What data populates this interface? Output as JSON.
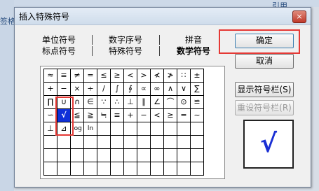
{
  "background": {
    "left_label": "签格",
    "right_label": "引用"
  },
  "dialog": {
    "title": "插入特殊符号",
    "close_symbol": "×",
    "tabs": {
      "row1": [
        "单位符号",
        "数字序号",
        "拼音"
      ],
      "row2": [
        "标点符号",
        "特殊符号",
        "数学符号"
      ],
      "active": "数学符号"
    },
    "grid": [
      [
        "≈",
        "≡",
        "≠",
        "=",
        "≤",
        "≥",
        "<",
        ">",
        "≮",
        "≯",
        "∷",
        "±"
      ],
      [
        "+",
        "−",
        "×",
        "÷",
        "/",
        "∫",
        "∮",
        "∝",
        "∞",
        "∧",
        "∨",
        "∑"
      ],
      [
        "∏",
        "∪",
        "∩",
        "∈",
        "∵",
        "∴",
        "⊥",
        "∥",
        "∠",
        "⌒",
        "⊙",
        "≌"
      ],
      [
        "∽",
        "√",
        "≦",
        "≧",
        "≒",
        "≡",
        "+",
        "−",
        "<",
        "≥",
        "=",
        "~"
      ],
      [
        "⊥",
        "⊿",
        "log",
        "ln",
        "",
        "",
        "",
        "",
        "",
        "",
        "",
        ""
      ],
      [
        "",
        "",
        "",
        "",
        "",
        "",
        "",
        "",
        "",
        "",
        "",
        ""
      ],
      [
        "",
        "",
        "",
        "",
        "",
        "",
        "",
        "",
        "",
        "",
        "",
        ""
      ],
      [
        "",
        "",
        "",
        "",
        "",
        "",
        "",
        "",
        "",
        "",
        "",
        ""
      ]
    ],
    "selected_symbol": "√",
    "buttons": {
      "ok": "确定",
      "cancel": "取消",
      "show_bar": "显示符号栏(S)",
      "reset_bar": "重设符号栏(R)"
    },
    "preview_symbol": "√"
  }
}
